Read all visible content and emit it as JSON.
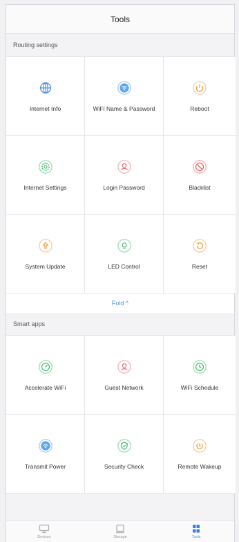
{
  "header": {
    "title": "Tools"
  },
  "routing": {
    "title": "Routing settings",
    "items": [
      {
        "label": "Internet Info",
        "icon": "globe-icon",
        "color": "#3f87e8"
      },
      {
        "label": "WiFi Name & Password",
        "icon": "wifi-icon",
        "color": "#4a9bf0"
      },
      {
        "label": "Reboot",
        "icon": "power-icon",
        "color": "#f29a3a"
      },
      {
        "label": "Internet Settings",
        "icon": "gear-icon",
        "color": "#3dbb6a"
      },
      {
        "label": "Login Password",
        "icon": "user-lock-icon",
        "color": "#f06a6a"
      },
      {
        "label": "Blacklist",
        "icon": "block-icon",
        "color": "#ee5a5a"
      },
      {
        "label": "System Update",
        "icon": "upload-icon",
        "color": "#f29a3a"
      },
      {
        "label": "LED Control",
        "icon": "bulb-icon",
        "color": "#3dbb6a"
      },
      {
        "label": "Reset",
        "icon": "reset-icon",
        "color": "#f29a3a"
      }
    ],
    "fold_label": "Fold ^"
  },
  "smart": {
    "title": "Smart apps",
    "items": [
      {
        "label": "Accelerate WiFi",
        "icon": "speedometer-icon",
        "color": "#3dbb6a"
      },
      {
        "label": "Guest Network",
        "icon": "guest-icon",
        "color": "#f06a6a"
      },
      {
        "label": "WiFi Schedule",
        "icon": "clock-icon",
        "color": "#3dbb6a"
      },
      {
        "label": "Transmit Power",
        "icon": "signal-icon",
        "color": "#4a9bf0"
      },
      {
        "label": "Security Check",
        "icon": "shield-icon",
        "color": "#3dbb6a"
      },
      {
        "label": "Remote Wakeup",
        "icon": "wakeup-icon",
        "color": "#f29a3a"
      }
    ]
  },
  "tabbar": {
    "tabs": [
      {
        "label": "Devices",
        "icon": "monitor-icon"
      },
      {
        "label": "Storage",
        "icon": "storage-icon"
      },
      {
        "label": "Tools",
        "icon": "tools-grid-icon",
        "active": true
      }
    ]
  }
}
